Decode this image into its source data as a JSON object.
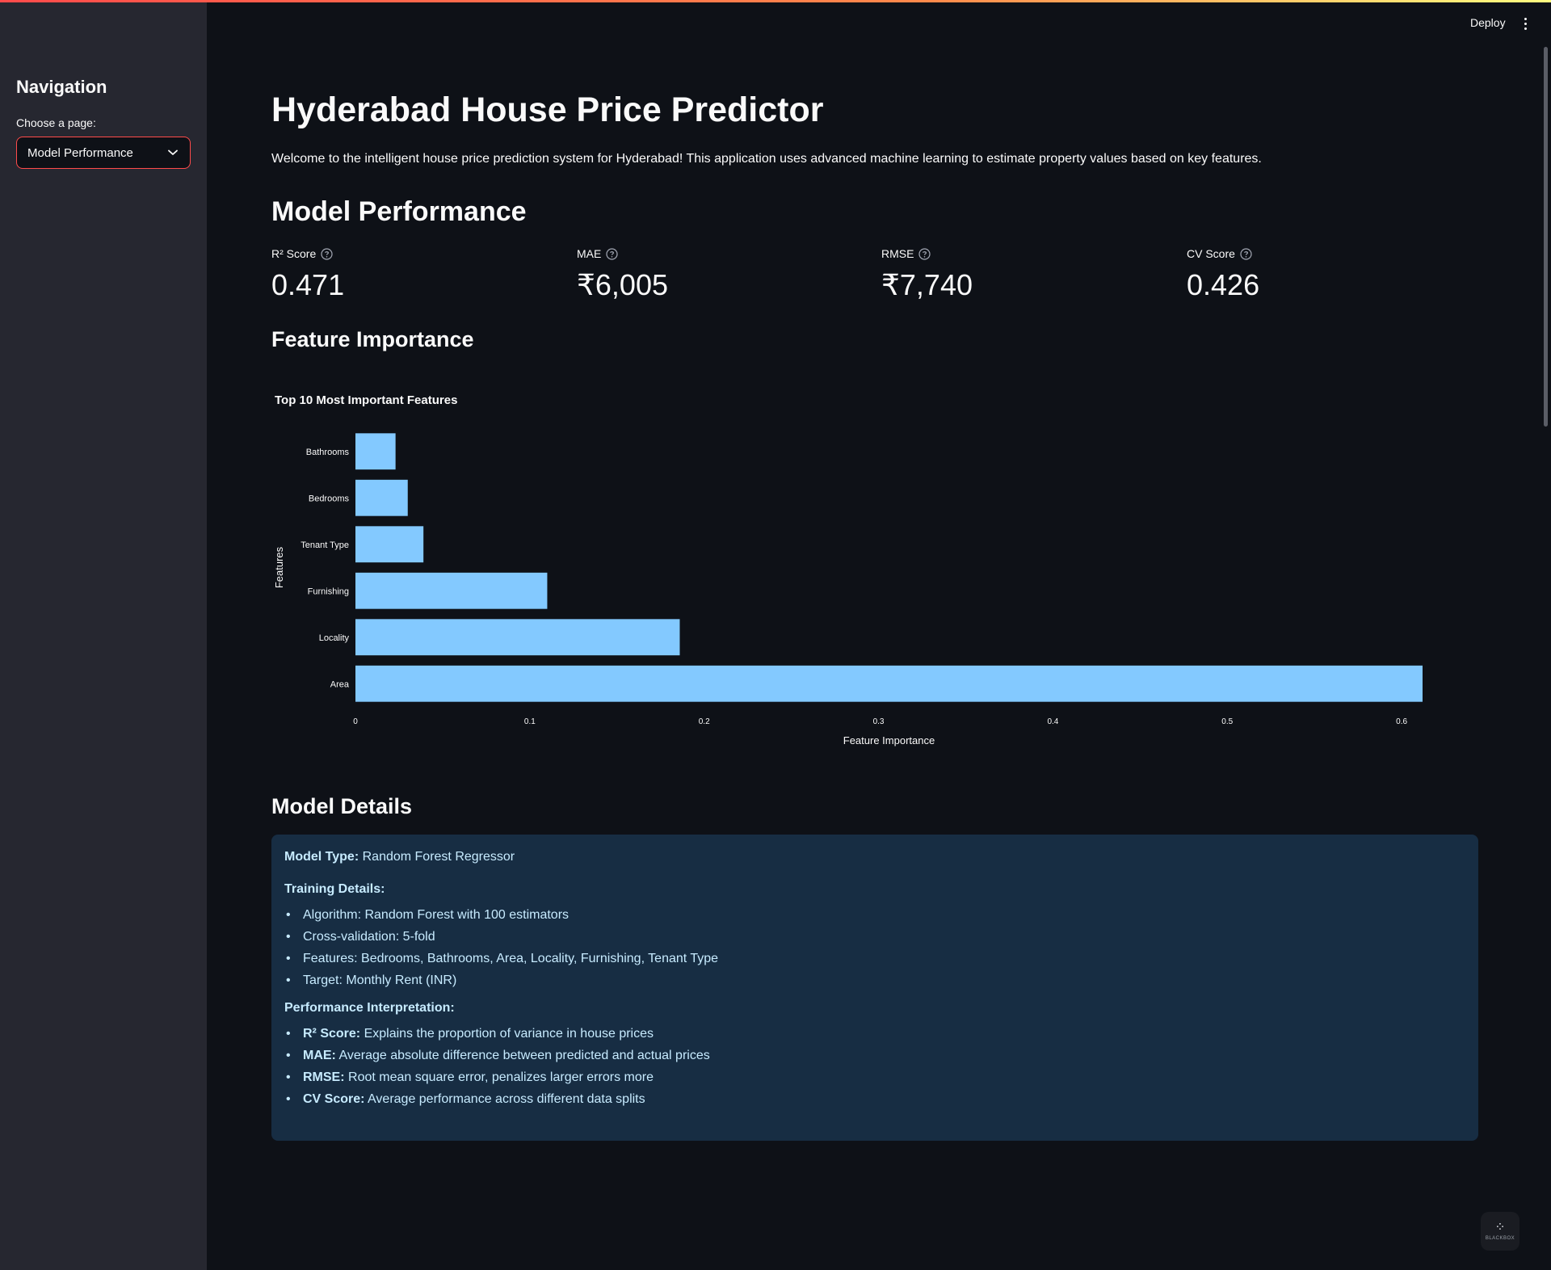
{
  "sidebar": {
    "title": "Navigation",
    "select_label": "Choose a page:",
    "select_value": "Model Performance"
  },
  "header": {
    "deploy_label": "Deploy"
  },
  "main": {
    "title": "Hyderabad House Price Predictor",
    "welcome": "Welcome to the intelligent house price prediction system for Hyderabad! This application uses advanced machine learning to estimate property values based on key features.",
    "section_title": "Model Performance",
    "metrics": [
      {
        "label": "R² Score",
        "value": "0.471"
      },
      {
        "label": "MAE",
        "value": "₹6,005"
      },
      {
        "label": "RMSE",
        "value": "₹7,740"
      },
      {
        "label": "CV Score",
        "value": "0.426"
      }
    ],
    "feature_title": "Feature Importance",
    "details_title": "Model Details",
    "details": {
      "model_type_label": "Model Type:",
      "model_type_value": "Random Forest Regressor",
      "training_title": "Training Details:",
      "training_items": [
        "Algorithm: Random Forest with 100 estimators",
        "Cross-validation: 5-fold",
        "Features: Bedrooms, Bathrooms, Area, Locality, Furnishing, Tenant Type",
        "Target: Monthly Rent (INR)"
      ],
      "interp_title": "Performance Interpretation:",
      "interp_items": [
        {
          "term": "R² Score:",
          "desc": "Explains the proportion of variance in house prices"
        },
        {
          "term": "MAE:",
          "desc": "Average absolute difference between predicted and actual prices"
        },
        {
          "term": "RMSE:",
          "desc": "Root mean square error, penalizes larger errors more"
        },
        {
          "term": "CV Score:",
          "desc": "Average performance across different data splits"
        }
      ]
    }
  },
  "chart_data": {
    "type": "bar",
    "orientation": "horizontal",
    "title": "Top 10 Most Important Features",
    "xlabel": "Feature Importance",
    "ylabel": "Features",
    "categories": [
      "Bathrooms",
      "Bedrooms",
      "Tenant Type",
      "Furnishing",
      "Locality",
      "Area"
    ],
    "values": [
      0.023,
      0.03,
      0.039,
      0.11,
      0.186,
      0.612
    ],
    "xlim": [
      0,
      0.612
    ],
    "xticks": [
      0,
      0.1,
      0.2,
      0.3,
      0.4,
      0.5,
      0.6
    ],
    "xtick_labels": [
      "0",
      "0.1",
      "0.2",
      "0.3",
      "0.4",
      "0.5",
      "0.6"
    ],
    "bar_color": "#83c9ff",
    "grid": false
  },
  "colors": {
    "background": "#0e1117",
    "sidebar": "#262730",
    "accent": "#ff4b4b",
    "info_box": "#172d43",
    "info_text": "#c7ebff"
  }
}
